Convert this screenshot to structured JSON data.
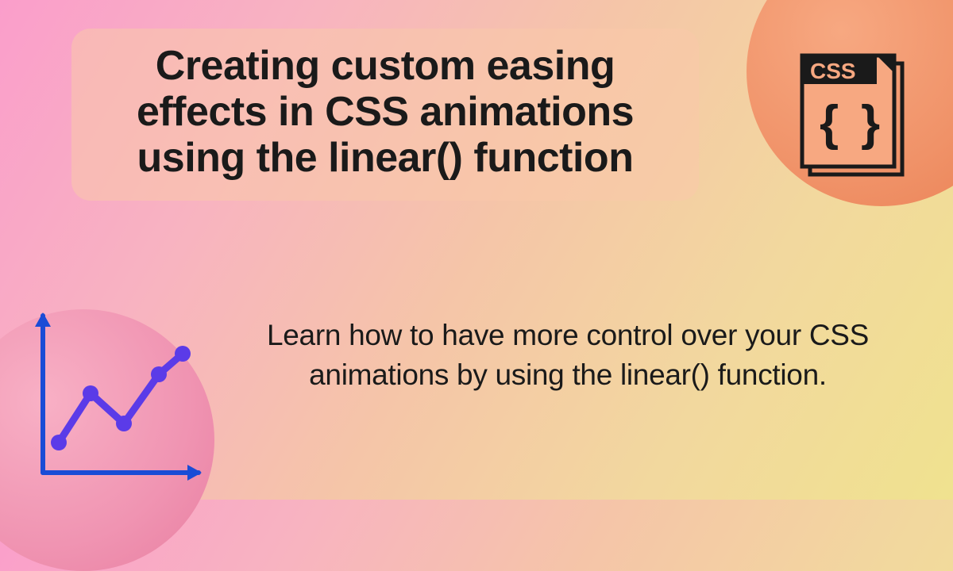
{
  "title": "Creating custom easing effects in CSS animations using the linear() function",
  "subtitle": "Learn how to have more control over your CSS animations by using the linear() function.",
  "cssIconLabel": "CSS",
  "colors": {
    "gradientStart": "#fa9ecb",
    "gradientEnd": "#f0e28f",
    "circleTopRight": "#f09268",
    "circleBottomLeft": "#f094b2",
    "chartLine": "#5b3be8",
    "chartAxes": "#1a4cd6",
    "textDark": "#1a1a1a"
  }
}
